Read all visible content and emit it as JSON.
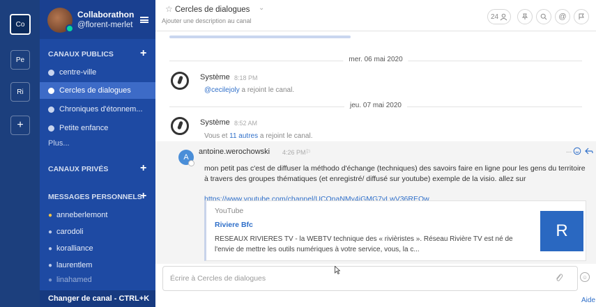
{
  "teams": [
    "Co",
    "Pe",
    "Ri",
    "+"
  ],
  "sidebar": {
    "team_name": "Collaborathon",
    "username": "@florent-merlet",
    "public_title": "CANAUX PUBLICS",
    "public_channels": [
      "centre-ville",
      "Cercles de dialogues",
      "Chroniques d'étonnem...",
      "Petite enfance"
    ],
    "more": "Plus...",
    "private_title": "CANAUX PRIVÉS",
    "dm_title": "MESSAGES PERSONNELS",
    "dms": [
      "anneberlemont",
      "carodoli",
      "koralliance",
      "laurentlem",
      "linahamed"
    ],
    "footer": "Changer de canal - CTRL+K",
    "colors": {
      "bg": "#1e4aa3",
      "active": "#3d6bc7",
      "rail": "#1c3f7d"
    }
  },
  "header": {
    "channel": "Cercles de dialogues",
    "description": "Ajouter une description au canal",
    "member_count": "24"
  },
  "posts": {
    "date1": "mer. 06 mai 2020",
    "date2": "jeu. 07 mai 2020",
    "system_name": "Système",
    "sys1_time": "8:18 PM",
    "sys1_user": "@cecilejoly",
    "sys1_text": " a rejoint le canal.",
    "sys2_time": "8:52 AM",
    "sys2_prefix": "Vous et ",
    "sys2_link": "11 autres",
    "sys2_text": " a rejoint le canal.",
    "author": "antoine.werochowski",
    "author_initial": "A",
    "author_time": "4:26 PM",
    "body": "mon petit pas c'est de diffuser la méthodo d'échange (techniques) des savoirs faire en ligne pour les gens du territoire à travers des groupes thématiques (et enregistré/ diffusé sur youtube) exemple de la visio. allez sur",
    "link": "https://www.youtube.com/channel/UCOnaNMy4iGMG7vLwV36REQw",
    "embed_site": "YouTube",
    "embed_title": "Riviere Bfc",
    "embed_desc": "RESEAUX RIVIERES TV - la WEBTV technique des « rivièristes ». Réseau Rivière TV est né de l'envie de mettre les outils numériques à votre service, vous, la c...",
    "embed_thumb": "R"
  },
  "input": {
    "placeholder": "Écrire à Cercles de dialogues",
    "help": "Aide"
  }
}
